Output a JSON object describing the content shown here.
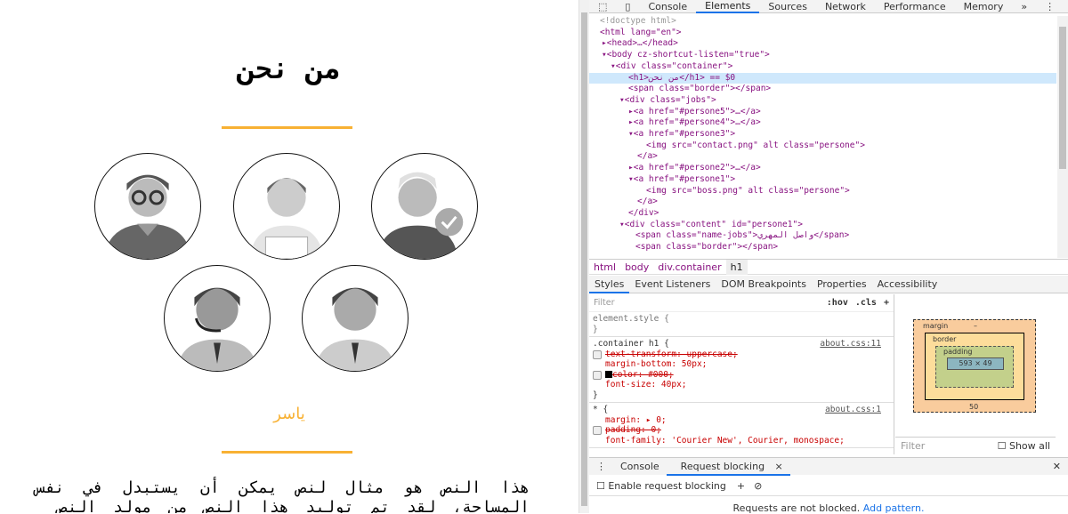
{
  "page": {
    "title": "من نحن",
    "name": "ياسر",
    "paragraph": "هذا النص هو مثال لنص يمكن أن يستبدل في نفس المساحة، لقد تم توليد هذا النص من مولد النص"
  },
  "devtools": {
    "tabs": [
      "Console",
      "Elements",
      "Sources",
      "Network",
      "Performance",
      "Memory"
    ],
    "more": "»",
    "dom": [
      "<!doctype html>",
      "<html lang=\"en\">",
      "<head>…</head>",
      "<body cz-shortcut-listen=\"true\">",
      "<div class=\"container\">",
      "<h1>من نحن</h1> == $0",
      "<span class=\"border\"></span>",
      "<div class=\"jobs\">",
      "<a href=\"#persone5\">…</a>",
      "<a href=\"#persone4\">…</a>",
      "<a href=\"#persone3\">",
      "<img src=\"contact.png\" alt class=\"persone\">",
      "</a>",
      "<a href=\"#persone2\">…</a>",
      "<a href=\"#persone1\">",
      "<img src=\"boss.png\" alt class=\"persone\">",
      "</a>",
      "</div>",
      "<div class=\"content\" id=\"persone1\">",
      "<span class=\"name-jobs\">واصل المهري</span>",
      "<span class=\"border\"></span>"
    ],
    "breadcrumbs": [
      "html",
      "body",
      "div.container",
      "h1"
    ],
    "style_tabs": [
      "Styles",
      "Event Listeners",
      "DOM Breakpoints",
      "Properties",
      "Accessibility"
    ],
    "filter_placeholder": "Filter",
    "hov": ":hov",
    "cls": ".cls",
    "rules": {
      "element_style": "element.style {",
      "close": "}",
      "r1_selector": ".container h1 {",
      "r1_src": "about.css:11",
      "r1_props": [
        "text-transform: uppercase;",
        "margin-bottom: 50px;",
        "color: #000;",
        "font-size: 40px;"
      ],
      "r2_selector": "* {",
      "r2_src": "about.css:1",
      "r2_props": [
        "margin: ▸ 0;",
        "padding: 0;",
        "font-family: 'Courier New', Courier, monospace;"
      ]
    },
    "box": {
      "margin": "margin",
      "border": "border",
      "padding": "padding",
      "content": "593 × 49",
      "dash": "–",
      "margin_bottom": "50"
    },
    "computed_filter": "Filter",
    "show_all": "Show all",
    "drawer_tabs": [
      "Console",
      "Request blocking"
    ],
    "enable_blocking": "Enable request blocking",
    "not_blocked": "Requests are not blocked.",
    "add_pattern": "Add pattern."
  }
}
